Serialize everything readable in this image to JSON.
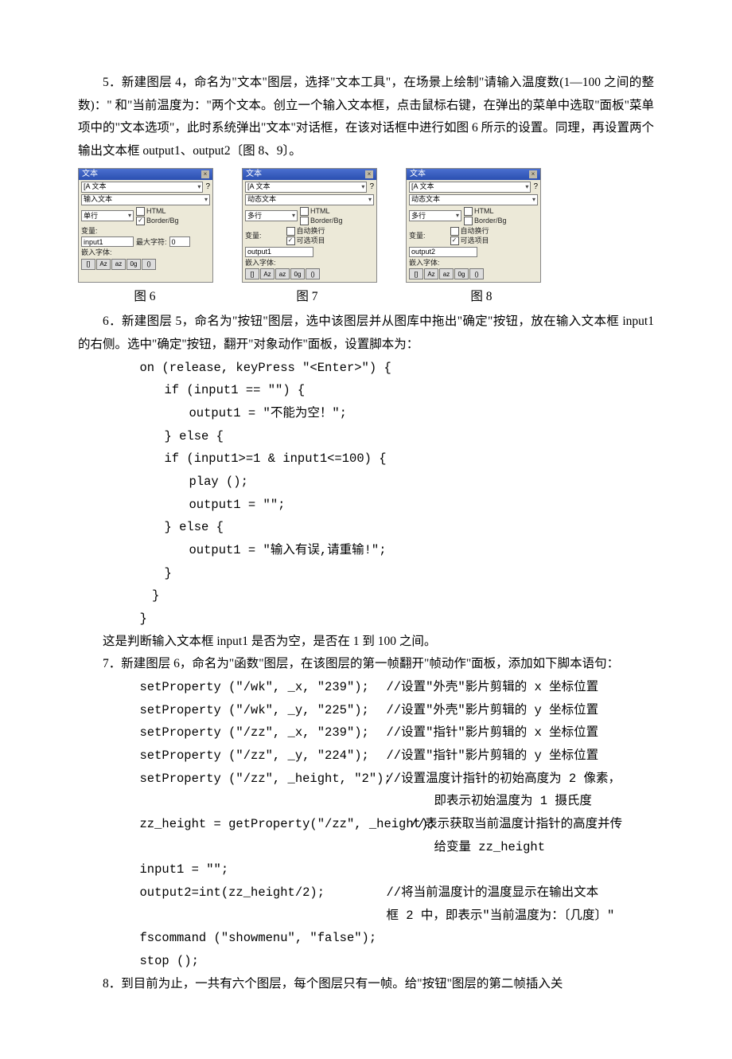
{
  "para5": "5．新建图层 4，命名为\"文本\"图层，选择\"文本工具\"，在场景上绘制\"请输入温度数(1—100 之间的整数)：\" 和\"当前温度为：\"两个文本。创立一个输入文本框，点击鼠标右键，在弹出的菜单中选取\"面板\"菜单项中的\"文本选项\"，此时系统弹出\"文本\"对话框，在该对话框中进行如图 6 所示的设置。同理，再设置两个输出文本框 output1、output2〔图 8、9〕。",
  "panels": {
    "title": "文本",
    "tab": "[A 文本",
    "close": "×",
    "p6": {
      "type": "输入文本",
      "row2a": "单行",
      "html": "HTML",
      "border": "Border/Bg",
      "varlabel": "变量:",
      "var": "input1",
      "maxlabel": "最大字符:",
      "max": "0",
      "fontlabel": "嵌入字体:",
      "btns": [
        "[]",
        "Az",
        "az",
        "0g",
        "()"
      ]
    },
    "p7": {
      "type": "动态文本",
      "row2a": "多行",
      "html": "HTML",
      "border": "Border/Bg",
      "auto": "自动换行",
      "sel": "可选项目",
      "varlabel": "变量:",
      "var": "output1",
      "fontlabel": "嵌入字体:",
      "btns": [
        "[]",
        "Az",
        "az",
        "0g",
        "()"
      ]
    },
    "p8": {
      "type": "动态文本",
      "row2a": "多行",
      "html": "HTML",
      "border": "Border/Bg",
      "auto": "自动换行",
      "sel": "可选项目",
      "varlabel": "变量:",
      "var": "output2",
      "fontlabel": "嵌入字体:",
      "btns": [
        "[]",
        "Az",
        "az",
        "0g",
        "()"
      ]
    }
  },
  "captions": {
    "c6": "图 6",
    "c7": "图 7",
    "c8": "图 8"
  },
  "para6a": "6．新建图层 5，命名为\"按钮\"图层，选中该图层并从图库中拖出\"确定\"按钮，放在输入文本框 input1 的右侧。选中\"确定\"按钮，翻开\"对象动作\"面板，设置脚本为：",
  "code6": {
    "l1": "on (release, keyPress \"<Enter>\") {",
    "l2": "if (input1 == \"\") {",
    "l3": "output1 = \"不能为空！\";",
    "l4": "} else {",
    "l5": "if (input1>=1 & input1<=100) {",
    "l6": "play ();",
    "l7": "output1 = \"\";",
    "l8": "} else {",
    "l9": "output1 = \"输入有误,请重输!\";",
    "l10": "}",
    "l11": "}",
    "l12": "}"
  },
  "para6b": "这是判断输入文本框 input1 是否为空，是否在 1 到 100 之间。",
  "para7": "7．新建图层 6，命名为\"函数\"图层，在该图层的第一帧翻开\"帧动作\"面板，添加如下脚本语句：",
  "code7": {
    "r1l": "setProperty (\"/wk\", _x, \"239\");",
    "r1r": "//设置\"外壳\"影片剪辑的 x 坐标位置",
    "r2l": "setProperty (\"/wk\", _y, \"225\");",
    "r2r": "//设置\"外壳\"影片剪辑的 y 坐标位置",
    "r3l": "setProperty (\"/zz\", _x, \"239\");",
    "r3r": "//设置\"指针\"影片剪辑的 x 坐标位置",
    "r4l": "setProperty (\"/zz\", _y, \"224\");",
    "r4r": "//设置\"指针\"影片剪辑的 y 坐标位置",
    "r5l": "setProperty (\"/zz\", _height, \"2\");",
    "r5r": "//设置温度计指针的初始高度为 2 像素，",
    "r5r2": "即表示初始温度为 1 摄氏度",
    "r6l": "zz_height = getProperty(\"/zz\", _height);",
    "r6r": "//表示获取当前温度计指针的高度并传",
    "r6r2": "给变量 zz_height",
    "r7": "input1 = \"\";",
    "r8l": "output2=int(zz_height/2);",
    "r8r": "//将当前温度计的温度显示在输出文本",
    "r8r2": "框 2 中，即表示\"当前温度为：〔几度〕\"",
    "r9": "fscommand (\"showmenu\", \"false\");",
    "r10": "stop ();"
  },
  "para8": "8．到目前为止，一共有六个图层，每个图层只有一帧。给\"按钮\"图层的第二帧插入关"
}
